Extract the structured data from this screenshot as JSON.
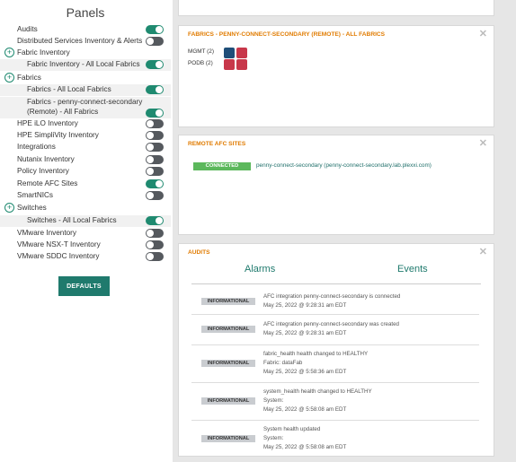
{
  "panels": {
    "title": "Panels",
    "items": [
      {
        "label": "Audits",
        "indent": false,
        "expand": false,
        "sub": false,
        "on": true
      },
      {
        "label": "Distributed Services Inventory & Alerts",
        "indent": false,
        "expand": false,
        "sub": false,
        "on": false
      },
      {
        "label": "Fabric Inventory",
        "indent": false,
        "expand": true,
        "sub": false,
        "on": null
      },
      {
        "label": "Fabric Inventory - All Local Fabrics",
        "indent": true,
        "expand": false,
        "sub": true,
        "on": true
      },
      {
        "label": "Fabrics",
        "indent": false,
        "expand": true,
        "sub": false,
        "on": null
      },
      {
        "label": "Fabrics - All Local Fabrics",
        "indent": true,
        "expand": false,
        "sub": true,
        "on": true
      },
      {
        "label": "Fabrics - penny-connect-secondary",
        "label2": "(Remote) - All Fabrics",
        "indent": true,
        "expand": false,
        "sub": true,
        "on": true
      },
      {
        "label": "HPE iLO Inventory",
        "indent": false,
        "expand": false,
        "sub": false,
        "on": false
      },
      {
        "label": "HPE SimpliVity Inventory",
        "indent": false,
        "expand": false,
        "sub": false,
        "on": false
      },
      {
        "label": "Integrations",
        "indent": false,
        "expand": false,
        "sub": false,
        "on": false
      },
      {
        "label": "Nutanix Inventory",
        "indent": false,
        "expand": false,
        "sub": false,
        "on": false
      },
      {
        "label": "Policy Inventory",
        "indent": false,
        "expand": false,
        "sub": false,
        "on": false
      },
      {
        "label": "Remote AFC Sites",
        "indent": false,
        "expand": false,
        "sub": false,
        "on": true
      },
      {
        "label": "SmartNICs",
        "indent": false,
        "expand": false,
        "sub": false,
        "on": false
      },
      {
        "label": "Switches",
        "indent": false,
        "expand": true,
        "sub": false,
        "on": null
      },
      {
        "label": "Switches - All Local Fabrics",
        "indent": true,
        "expand": false,
        "sub": true,
        "on": true
      },
      {
        "label": "VMware Inventory",
        "indent": false,
        "expand": false,
        "sub": false,
        "on": false
      },
      {
        "label": "VMware NSX-T Inventory",
        "indent": false,
        "expand": false,
        "sub": false,
        "on": false
      },
      {
        "label": "VMware SDDC Inventory",
        "indent": false,
        "expand": false,
        "sub": false,
        "on": false
      }
    ],
    "defaults_label": "DEFAULTS"
  },
  "fabrics_card": {
    "title": "FABRICS - PENNY-CONNECT-SECONDARY (REMOTE) - ALL FABRICS",
    "rows": [
      {
        "label": "MGMT (2)",
        "colors": [
          "#1f4e79",
          "#c8374a"
        ]
      },
      {
        "label": "PODB (2)",
        "colors": [
          "#c8374a",
          "#c8374a"
        ]
      }
    ]
  },
  "remote_card": {
    "title": "REMOTE AFC SITES",
    "status": "CONNECTED",
    "site": "penny-connect-secondary (penny-connect-secondary.lab.plexxi.com)"
  },
  "audits_card": {
    "title": "AUDITS",
    "tabs": {
      "alarms": "Alarms",
      "events": "Events"
    },
    "items": [
      {
        "level": "INFORMATIONAL",
        "lines": [
          "AFC integration penny-connect-secondary is connected",
          "May 25, 2022 @ 9:28:31 am EDT"
        ]
      },
      {
        "level": "INFORMATIONAL",
        "lines": [
          "AFC integration penny-connect-secondary was created",
          "May 25, 2022 @ 9:28:31 am EDT"
        ]
      },
      {
        "level": "INFORMATIONAL",
        "lines": [
          "fabric_health health changed to HEALTHY",
          "Fabric: dataFab",
          "May 25, 2022 @ 5:58:36 am EDT"
        ]
      },
      {
        "level": "INFORMATIONAL",
        "lines": [
          "system_health health changed to HEALTHY",
          "System:",
          "May 25, 2022 @ 5:58:08 am EDT"
        ]
      },
      {
        "level": "INFORMATIONAL",
        "lines": [
          "System health updated",
          "System:",
          "May 25, 2022 @ 5:58:08 am EDT"
        ]
      }
    ]
  },
  "colors": {
    "accent": "#1f8a70",
    "title_orange": "#e07b00",
    "connected_green": "#5cb85c"
  },
  "icons": {
    "close": "close-icon",
    "expand": "plus-circle-icon"
  }
}
